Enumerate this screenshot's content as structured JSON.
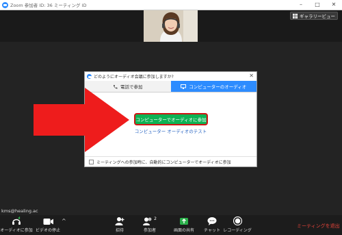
{
  "window": {
    "title": "Zoom 参加者 ID: 36 ミーティング ID",
    "minimize": "–",
    "maximize": "□",
    "close": "✕"
  },
  "topbar": {
    "gallery_view_label": "ギャラリービュー"
  },
  "dialog": {
    "title": "どのようにオーディオ会議に参加しますか?",
    "tabs": [
      {
        "label": "電話で参加",
        "active": false
      },
      {
        "label": "コンピューターのオーディオ",
        "active": true
      }
    ],
    "join_button_label": "コンピューターでオーディオに参加",
    "test_link_label": "コンピューター オーディオのテスト",
    "auto_join_label": "ミーティングへの参加時に、自動的にコンピューターでオーディオに参加",
    "auto_join_checked": false
  },
  "user": {
    "name": "kms@healing.ac"
  },
  "toolbar": {
    "items": [
      {
        "label": "オーディオに参加",
        "icon": "headphones-icon"
      },
      {
        "label": "ビデオの停止",
        "icon": "video-camera-icon"
      },
      {
        "label": "招待",
        "icon": "invite-icon"
      },
      {
        "label": "参加者",
        "icon": "participants-icon",
        "count": "2"
      },
      {
        "label": "画面の共有",
        "icon": "share-screen-icon"
      },
      {
        "label": "チャット",
        "icon": "chat-icon"
      },
      {
        "label": "レコーディング",
        "icon": "record-icon"
      }
    ],
    "leave_label": "ミーティングを退出"
  },
  "colors": {
    "accent_blue": "#2d8cff",
    "join_green": "#0eb254",
    "highlight_red": "#d01414",
    "leave_red": "#e8443a",
    "arrow_red": "#ee1c1c"
  }
}
